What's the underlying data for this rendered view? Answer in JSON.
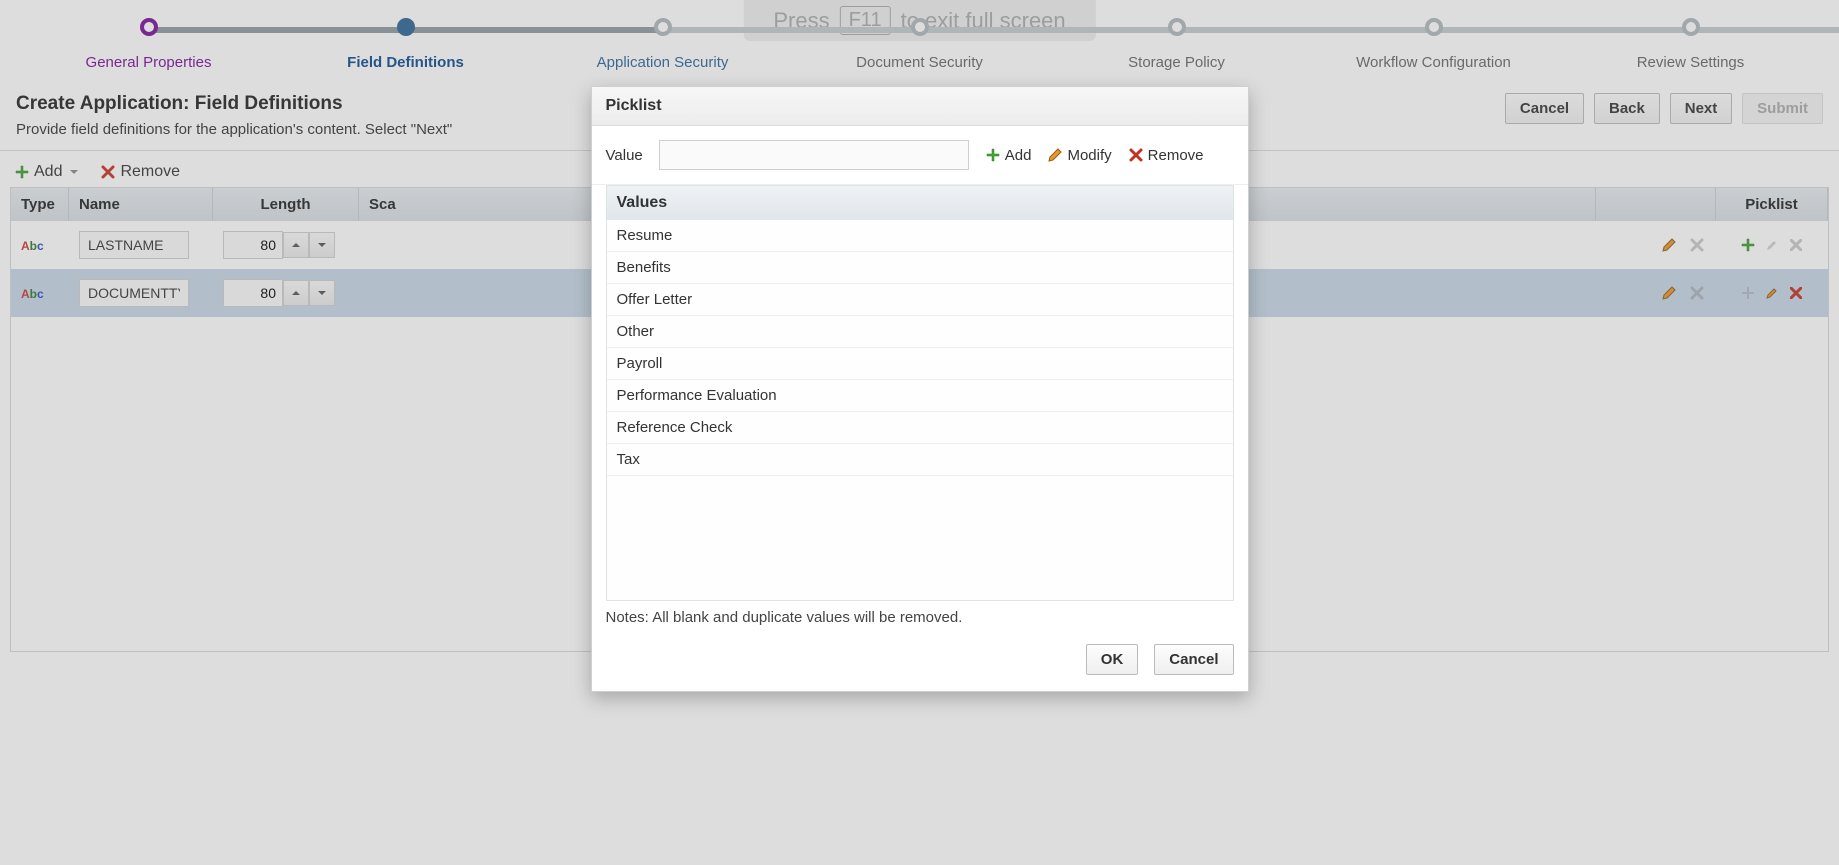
{
  "fullscreen_hint": {
    "pre": "Press",
    "key": "F11",
    "post": "to exit full screen"
  },
  "wizard": [
    {
      "label": "General Properties",
      "state": "visited"
    },
    {
      "label": "Field Definitions",
      "state": "current"
    },
    {
      "label": "Application Security",
      "state": "link"
    },
    {
      "label": "Document Security",
      "state": "pend"
    },
    {
      "label": "Storage Policy",
      "state": "pend"
    },
    {
      "label": "Workflow Configuration",
      "state": "pend"
    },
    {
      "label": "Review Settings",
      "state": "pend"
    }
  ],
  "page": {
    "title": "Create Application: Field Definitions",
    "subtitle": "Provide field definitions for the application's content. Select \"Next\""
  },
  "buttons": {
    "cancel": "Cancel",
    "back": "Back",
    "next": "Next",
    "submit": "Submit"
  },
  "toolbar": {
    "add": "Add",
    "remove": "Remove"
  },
  "columns": {
    "type": "Type",
    "name": "Name",
    "length": "Length",
    "scale": "Sca",
    "picklist": "Picklist"
  },
  "rows": [
    {
      "name": "LASTNAME",
      "length": "80"
    },
    {
      "name": "DOCUMENTTY",
      "length": "80"
    }
  ],
  "modal": {
    "title": "Picklist",
    "value_label": "Value",
    "value": "",
    "add": "Add",
    "modify": "Modify",
    "remove": "Remove",
    "values_header": "Values",
    "values": [
      "Resume",
      "Benefits",
      "Offer Letter",
      "Other",
      "Payroll",
      "Performance Evaluation",
      "Reference Check",
      "Tax"
    ],
    "notes": "Notes: All blank and duplicate values will be removed.",
    "ok": "OK",
    "cancel": "Cancel"
  }
}
